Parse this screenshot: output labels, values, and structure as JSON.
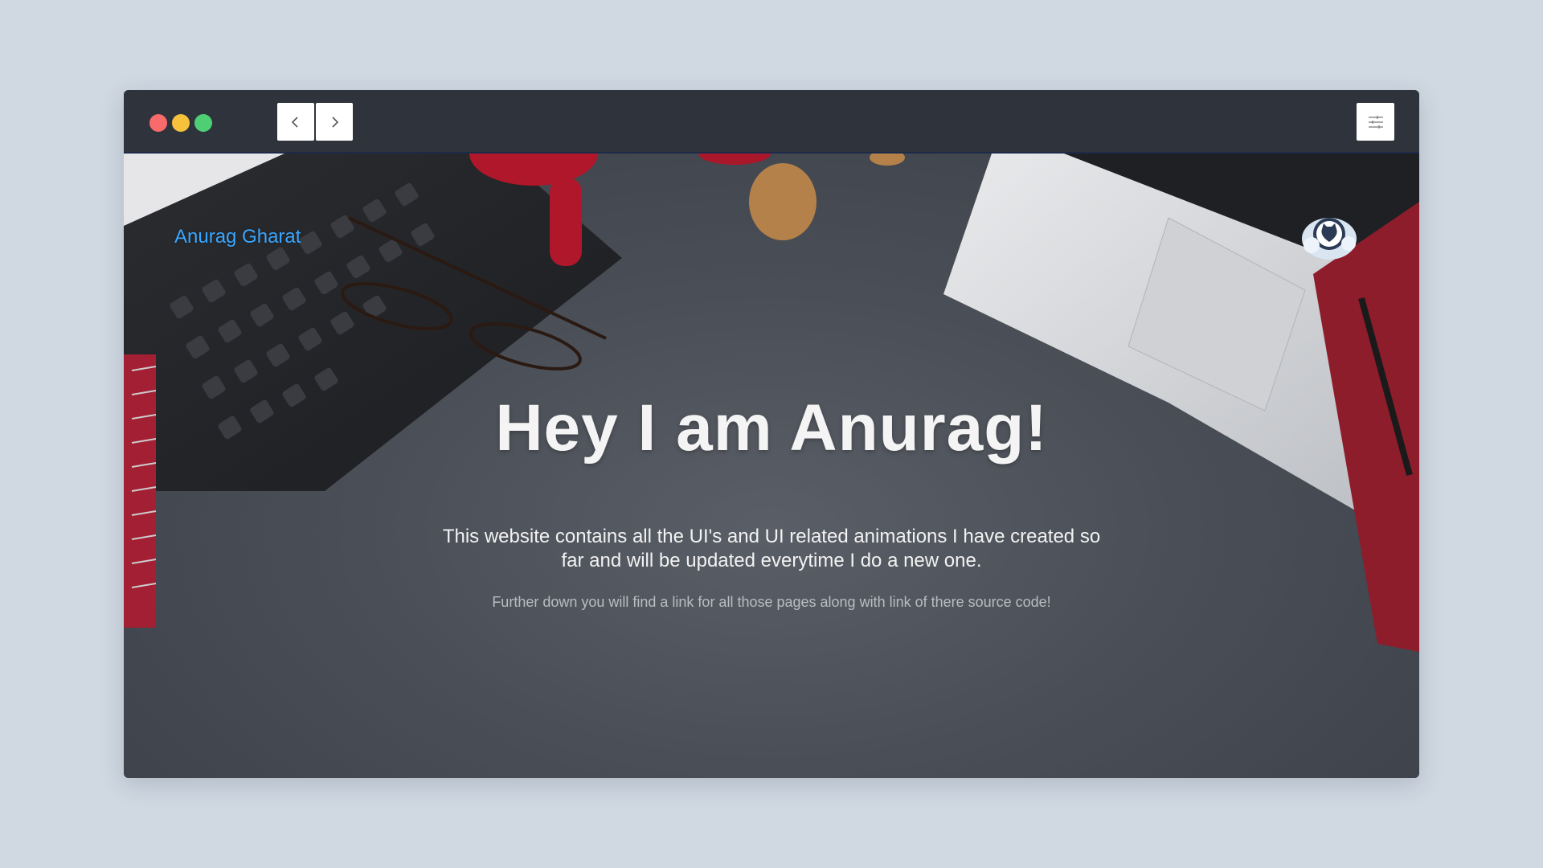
{
  "window": {
    "controls": [
      "close",
      "minimize",
      "maximize"
    ],
    "nav": {
      "back_icon": "chevron-left-icon",
      "forward_icon": "chevron-right-icon"
    },
    "settings_icon": "sliders-icon"
  },
  "page": {
    "brand": "Anurag Gharat",
    "heading": "Hey I am Anurag!",
    "description": "This website contains all the UI's and UI related animations I have created so far and will be updated everytime I do a new one.",
    "subtext": "Further down you will find a link for all those pages along with link of there source code!",
    "github_icon": "github-octocat-icon"
  },
  "colors": {
    "page_bg": "#d0d8e2",
    "titlebar": "#2f343c",
    "brand_link": "#3aa6ff",
    "dot_red": "#f96a6a",
    "dot_yellow": "#f6c23b",
    "dot_green": "#4fcf74"
  }
}
